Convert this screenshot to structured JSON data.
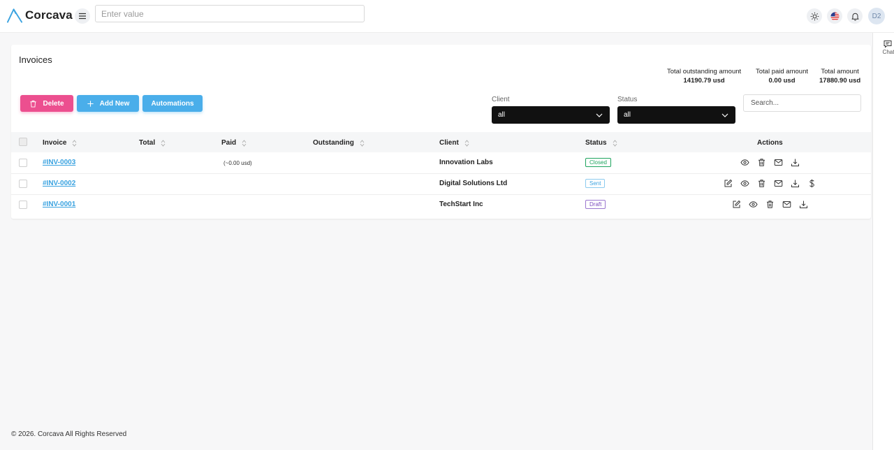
{
  "app": {
    "name": "Corcava"
  },
  "header": {
    "search_placeholder": "Enter value",
    "avatar_initials": "D2",
    "icons": [
      "menu-icon",
      "sun-icon",
      "us-flag-icon",
      "bell-icon"
    ]
  },
  "sidebar_right": {
    "chat_label": "Chat"
  },
  "page": {
    "title": "Invoices"
  },
  "summary": [
    {
      "label": "Total outstanding amount",
      "value": "14190.79 usd"
    },
    {
      "label": "Total paid amount",
      "value": "0.00 usd"
    },
    {
      "label": "Total amount",
      "value": "17880.90 usd"
    }
  ],
  "toolbar": {
    "delete_label": "Delete",
    "add_label": "Add New",
    "automations_label": "Automations"
  },
  "filters": {
    "client_label": "Client",
    "client_value": "all",
    "status_label": "Status",
    "status_value": "all",
    "search_placeholder": "Search..."
  },
  "table": {
    "columns": [
      "Invoice",
      "Total",
      "Paid",
      "Outstanding",
      "Client",
      "Status",
      "Actions"
    ],
    "rows": [
      {
        "invoice": "#INV-0003",
        "total": "",
        "paid": "(~0.00 usd)",
        "outstanding": "",
        "client": "Innovation Labs",
        "status": "Closed",
        "actions": [
          "view",
          "delete",
          "email",
          "download"
        ]
      },
      {
        "invoice": "#INV-0002",
        "total": "",
        "paid": "",
        "outstanding": "",
        "client": "Digital Solutions Ltd",
        "status": "Sent",
        "actions": [
          "edit",
          "view",
          "delete",
          "email",
          "download",
          "payment"
        ]
      },
      {
        "invoice": "#INV-0001",
        "total": "",
        "paid": "",
        "outstanding": "",
        "client": "TechStart Inc",
        "status": "Draft",
        "actions": [
          "edit",
          "view",
          "delete",
          "email",
          "download"
        ]
      }
    ]
  },
  "footer": {
    "text": "© 2026. Corcava All Rights Reserved"
  },
  "colors": {
    "delete": "#ec4f8f",
    "primary": "#4aaeea",
    "closed": "#1ea45e",
    "draft": "#7b4bbd"
  }
}
